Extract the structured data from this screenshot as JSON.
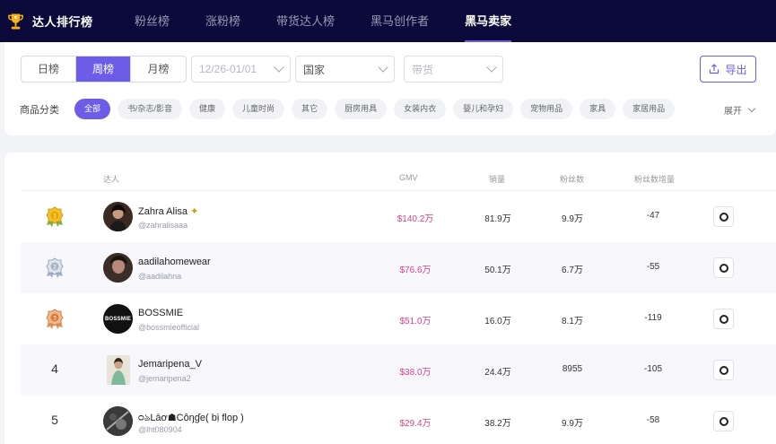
{
  "app": {
    "brand": "达人排行榜",
    "nav_tabs": [
      {
        "label": "粉丝榜"
      },
      {
        "label": "涨粉榜"
      },
      {
        "label": "带货达人榜"
      },
      {
        "label": "黑马创作者"
      },
      {
        "label": "黑马卖家"
      }
    ],
    "active_tab": "黑马卖家"
  },
  "filters": {
    "period": [
      "日榜",
      "周榜",
      "月榜"
    ],
    "active_period": "周榜",
    "date_range": "12/26-01/01",
    "country": "国家",
    "goods": "带货",
    "export_label": "导出",
    "category_label": "商品分类",
    "categories": [
      "全部",
      "书/杂志/影音",
      "健康",
      "儿童时尚",
      "其它",
      "厨房用具",
      "女装内衣",
      "婴儿和孕妇",
      "宠物用品",
      "家具",
      "家居用品"
    ],
    "active_category": "全部",
    "expand_label": "展开"
  },
  "table": {
    "headers": {
      "creator": "达人",
      "gmv": "GMV",
      "sales": "销量",
      "fans": "粉丝数",
      "fans_growth": "粉丝数增量"
    },
    "rows": [
      {
        "rank": "1",
        "name": "Zahra Alisa",
        "handle": "@zahralisaaa",
        "gmv": "$140.2万",
        "sales": "81.9万",
        "fans": "9.9万",
        "growth": "-47",
        "avatar_color": "#3a2a22",
        "badge": "gold"
      },
      {
        "rank": "2",
        "name": "aadilahomewear",
        "handle": "@aadilahna",
        "gmv": "$76.6万",
        "sales": "50.1万",
        "fans": "6.7万",
        "growth": "-55",
        "avatar_color": "#4a3a33",
        "badge": "silver"
      },
      {
        "rank": "3",
        "name": "BOSSMIE",
        "handle": "@bossmieofficial",
        "gmv": "$51.0万",
        "sales": "16.0万",
        "fans": "8.1万",
        "growth": "-119",
        "avatar_color": "#111111",
        "avatar_text": "BOSSMIE",
        "badge": "bronze"
      },
      {
        "rank": "4",
        "name": "Jemaripena_V",
        "handle": "@jemaripena2",
        "gmv": "$38.0万",
        "sales": "24.4万",
        "fans": "8955",
        "growth": "-105",
        "avatar_color": "#d9d2c8"
      },
      {
        "rank": "5",
        "name": "ᴑঌLāơ☗Côŋɠe( bị flop )",
        "handle": "@lht080904",
        "gmv": "$29.4万",
        "sales": "38.2万",
        "fans": "9.9万",
        "growth": "-58",
        "avatar_color": "#2b2b2b"
      }
    ]
  },
  "colors": {
    "accent": "#6c5ce7",
    "nav_bg": "#0b0a3a",
    "gmv": "#e0408c"
  }
}
